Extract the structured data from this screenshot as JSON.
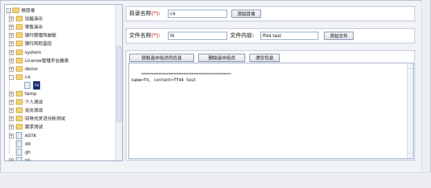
{
  "tree": {
    "root_label": "根目录",
    "items": [
      {
        "label": "功能演示",
        "type": "folder",
        "expander": "+"
      },
      {
        "label": "零售演示",
        "type": "folder",
        "expander": "+"
      },
      {
        "label": "银行管理驾驶舱",
        "type": "folder",
        "expander": "+"
      },
      {
        "label": "银行风险监控",
        "type": "folder",
        "expander": "+"
      },
      {
        "label": "system",
        "type": "folder",
        "expander": "+"
      },
      {
        "label": "License管理平台报表",
        "type": "folder",
        "expander": "+"
      },
      {
        "label": "demo",
        "type": "folder",
        "expander": "+"
      },
      {
        "label": "c4",
        "type": "folder",
        "expander": "-"
      },
      {
        "label": "f4",
        "type": "file",
        "expander": "",
        "selected": true
      },
      {
        "label": "temp",
        "type": "folder",
        "expander": "+"
      },
      {
        "label": "个人测试",
        "type": "folder",
        "expander": "+"
      },
      {
        "label": "兑文测试",
        "type": "folder",
        "expander": "+"
      },
      {
        "label": "向导式灵活分析测试",
        "type": "folder",
        "expander": "+"
      },
      {
        "label": "需求测试",
        "type": "folder",
        "expander": "+"
      },
      {
        "label": "ASTK",
        "type": "file",
        "expander": "+"
      },
      {
        "label": "dd",
        "type": "file",
        "expander": ""
      },
      {
        "label": "gh",
        "type": "file",
        "expander": ""
      },
      {
        "label": "hh",
        "type": "file",
        "expander": "+"
      }
    ]
  },
  "dir_form": {
    "label": "目录名称",
    "required_mark": "(*)",
    "colon": ":",
    "value": "c4",
    "add_button": "添加目录"
  },
  "file_form": {
    "label": "文件名称",
    "required_mark": "(*)",
    "colon": ":",
    "value": "f4",
    "content_label": "文件内容:",
    "content_value": "ff44 test",
    "add_button": "添加文件"
  },
  "actions": {
    "get_selected": "获取选中结点的信息",
    "delete_selected": "删除选中结点",
    "clear": "清空信息"
  },
  "output": {
    "text": "====================================\nname=f4, content=ff44 test"
  }
}
